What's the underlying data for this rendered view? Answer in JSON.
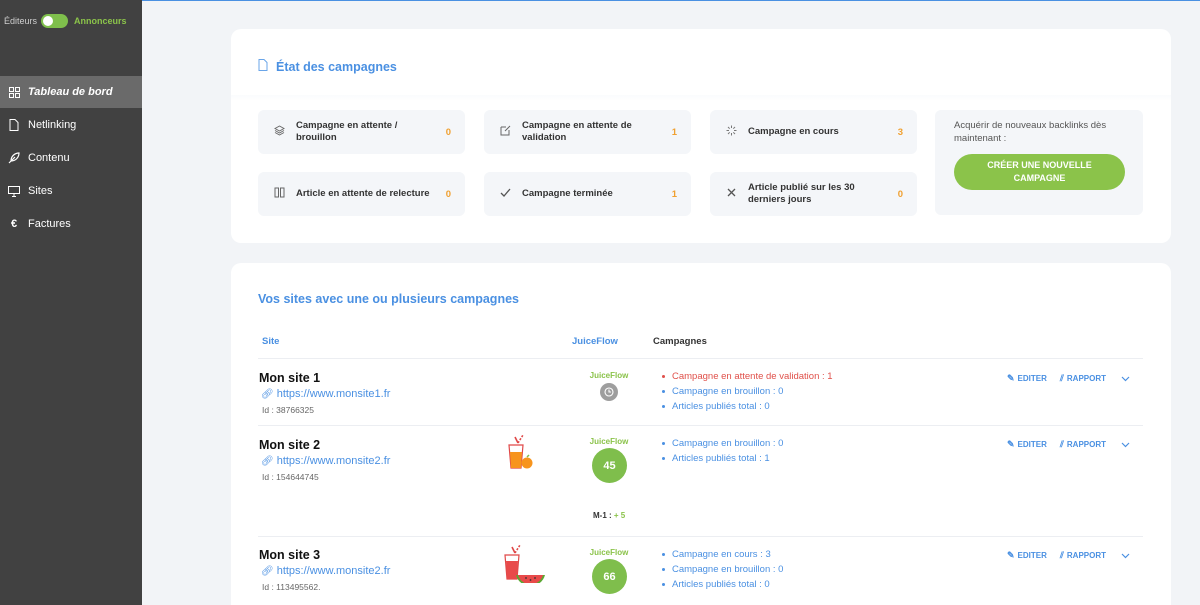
{
  "sidebar": {
    "toggle": {
      "left_label": "Éditeurs",
      "right_label": "Annonceurs"
    },
    "items": [
      {
        "label": "Tableau de bord",
        "icon": "grid-icon",
        "active": true
      },
      {
        "label": "Netlinking",
        "icon": "file-icon"
      },
      {
        "label": "Contenu",
        "icon": "feather-icon"
      },
      {
        "label": "Sites",
        "icon": "monitor-icon"
      },
      {
        "label": "Factures",
        "icon": "euro-icon"
      }
    ]
  },
  "campaign_status": {
    "title": "État des campagnes",
    "stats": [
      {
        "label": "Campagne en attente / brouillon",
        "value": "0",
        "icon": "layers-icon"
      },
      {
        "label": "Campagne en attente de validation",
        "value": "1",
        "icon": "edit-icon"
      },
      {
        "label": "Campagne en cours",
        "value": "3",
        "icon": "spinner-icon"
      },
      {
        "label": "Article en attente de relecture",
        "value": "0",
        "icon": "columns-icon"
      },
      {
        "label": "Campagne terminée",
        "value": "1",
        "icon": "check-icon"
      },
      {
        "label": "Article publié sur les 30 derniers jours",
        "value": "0",
        "icon": "x-icon"
      }
    ],
    "promo_text": "Acquérir de nouveaux backlinks dès maintenant :",
    "promo_button": "CRÉER UNE NOUVELLE CAMPAGNE"
  },
  "sites": {
    "title": "Vos sites avec une ou plusieurs campagnes",
    "headers": {
      "site": "Site",
      "juiceflow": "JuiceFlow",
      "campaigns": "Campagnes"
    },
    "edit_label": "EDITER",
    "report_label": "RAPPORT",
    "rows": [
      {
        "name": "Mon site 1",
        "url": "https://www.monsite1.fr",
        "id": "Id : 38766325",
        "juiceflow_label": "JuiceFlow",
        "score": null,
        "campaigns": [
          "Campagne en attente de validation : 1",
          "Campagne en brouillon : 0",
          "Articles publiés total : 0"
        ]
      },
      {
        "name": "Mon site 2",
        "url": "https://www.monsite2.fr",
        "id": "Id : 154644745",
        "juiceflow_label": "JuiceFlow",
        "score": "45",
        "m1_label": "M-1 :",
        "m1_value": "+ 5",
        "campaigns": [
          "Campagne en brouillon : 0",
          "Articles publiés total : 1"
        ]
      },
      {
        "name": "Mon site 3",
        "url": "https://www.monsite2.fr",
        "id": "Id : 113495562.",
        "juiceflow_label": "JuiceFlow",
        "score": "66",
        "campaigns": [
          "Campagne en cours : 3",
          "Campagne en brouillon : 0",
          "Articles publiés total : 0"
        ]
      }
    ]
  }
}
